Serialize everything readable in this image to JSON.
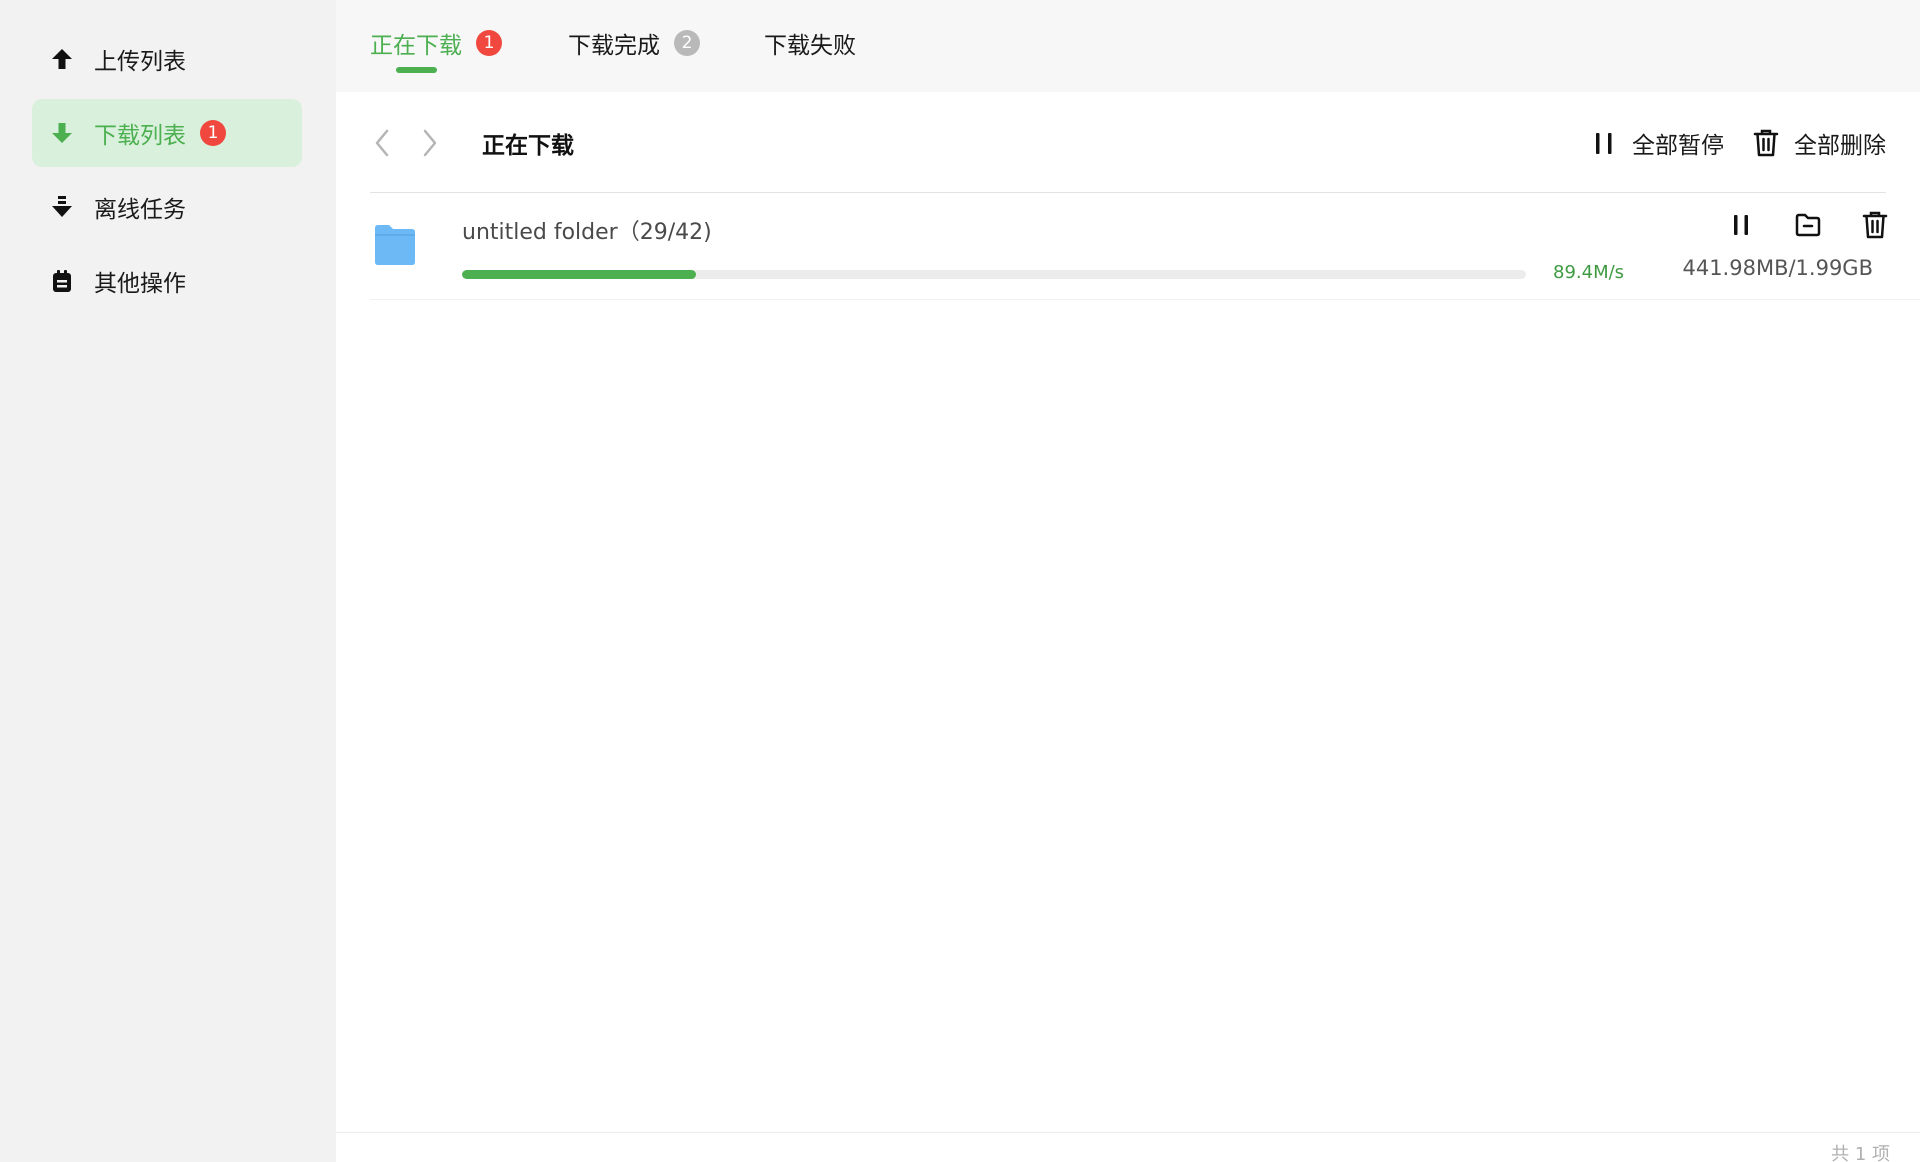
{
  "sidebar": {
    "items": [
      {
        "label": "上传列表",
        "icon": "upload-arrow-icon",
        "active": false
      },
      {
        "label": "下载列表",
        "icon": "download-arrow-icon",
        "active": true,
        "badge": "1"
      },
      {
        "label": "离线任务",
        "icon": "offline-download-icon",
        "active": false
      },
      {
        "label": "其他操作",
        "icon": "clipboard-icon",
        "active": false
      }
    ]
  },
  "tabs": [
    {
      "label": "正在下载",
      "badge": "1",
      "active": true
    },
    {
      "label": "下载完成",
      "badge": "2",
      "active": false
    },
    {
      "label": "下载失败",
      "active": false
    }
  ],
  "toolbar": {
    "title": "正在下载",
    "pause_all_label": "全部暂停",
    "delete_all_label": "全部删除"
  },
  "downloads": [
    {
      "name": "untitled folder（29/42)",
      "speed": "89.4M/s",
      "size": "441.98MB/1.99GB",
      "progress": 0.22,
      "icon": "folder-icon"
    }
  ],
  "footer": {
    "count_label": "共 1 项"
  },
  "colors": {
    "accent": "#4caf50",
    "badge_red": "#f0483e",
    "badge_gray": "#b9b9b9",
    "sidebar_bg": "#f2f2f2",
    "active_bg": "#d9f0dc",
    "folder": "#6cb9f5"
  }
}
